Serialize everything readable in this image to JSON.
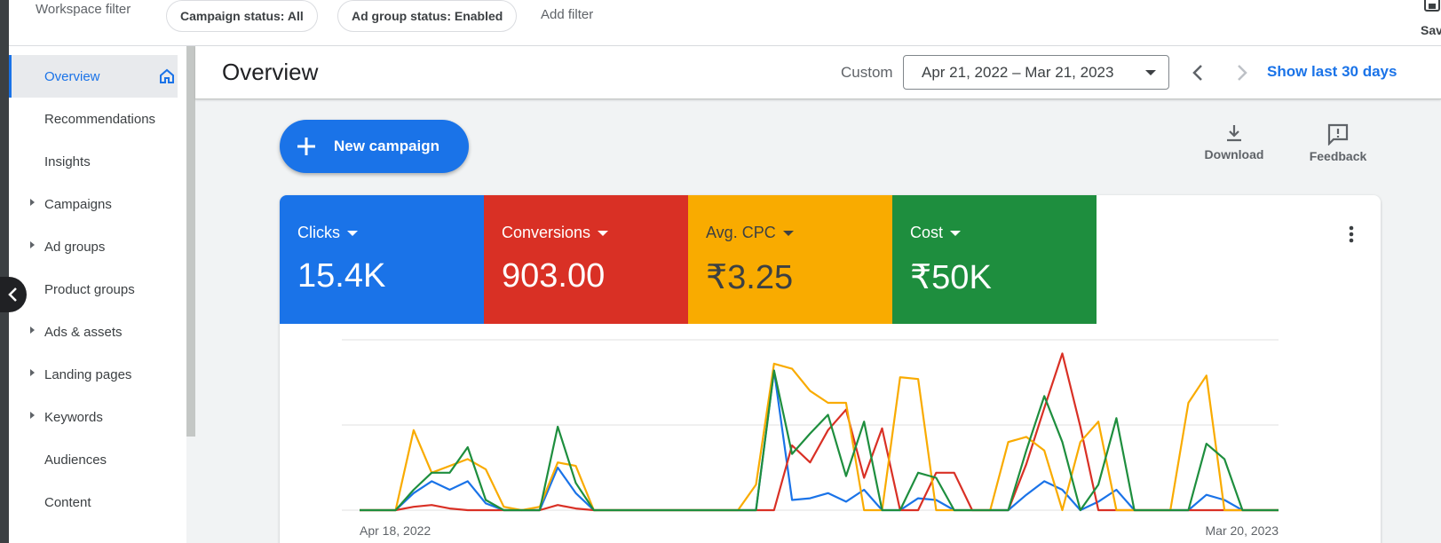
{
  "filter_bar": {
    "workspace_label": "Workspace filter",
    "chips": [
      "Campaign status: All",
      "Ad group status: Enabled"
    ],
    "add_filter": "Add filter",
    "save_label": "Save"
  },
  "sidebar": {
    "items": [
      {
        "label": "Overview",
        "active": true,
        "expandable": false
      },
      {
        "label": "Recommendations",
        "active": false,
        "expandable": false
      },
      {
        "label": "Insights",
        "active": false,
        "expandable": false
      },
      {
        "label": "Campaigns",
        "active": false,
        "expandable": true
      },
      {
        "label": "Ad groups",
        "active": false,
        "expandable": true
      },
      {
        "label": "Product groups",
        "active": false,
        "expandable": false
      },
      {
        "label": "Ads & assets",
        "active": false,
        "expandable": true
      },
      {
        "label": "Landing pages",
        "active": false,
        "expandable": true
      },
      {
        "label": "Keywords",
        "active": false,
        "expandable": true
      },
      {
        "label": "Audiences",
        "active": false,
        "expandable": false
      },
      {
        "label": "Content",
        "active": false,
        "expandable": false
      }
    ]
  },
  "header": {
    "title": "Overview",
    "range_type": "Custom",
    "date_range": "Apr 21, 2022 – Mar 21, 2023",
    "show_last": "Show last 30 days"
  },
  "actions": {
    "new_campaign": "New campaign",
    "download": "Download",
    "feedback": "Feedback"
  },
  "metrics": [
    {
      "label": "Clicks",
      "value": "15.4K",
      "color": "#1a73e8"
    },
    {
      "label": "Conversions",
      "value": "903.00",
      "color": "#d93025"
    },
    {
      "label": "Avg. CPC",
      "value": "₹3.25",
      "color": "#f9ab00"
    },
    {
      "label": "Cost",
      "value": "₹50K",
      "color": "#1e8e3e"
    }
  ],
  "chart_data": {
    "type": "line",
    "x_start_label": "Apr 18, 2022",
    "x_end_label": "Mar 20, 2023",
    "ylim": [
      0,
      100
    ],
    "grid": true,
    "series": [
      {
        "color": "#1a73e8",
        "values": [
          0,
          0,
          0,
          10,
          17,
          12,
          17,
          4,
          0,
          0,
          0,
          25,
          10,
          0,
          0,
          0,
          0,
          0,
          0,
          0,
          0,
          0,
          0,
          82,
          6,
          7,
          10,
          5,
          12,
          0,
          0,
          7,
          6,
          0,
          0,
          0,
          0,
          9,
          17,
          12,
          0,
          5,
          12,
          0,
          0,
          0,
          0,
          9,
          6,
          0,
          0,
          0
        ]
      },
      {
        "color": "#d93025",
        "values": [
          0,
          0,
          0,
          2,
          3,
          1,
          0,
          0,
          0,
          0,
          0,
          3,
          1,
          0,
          0,
          0,
          0,
          0,
          0,
          0,
          0,
          0,
          0,
          0,
          38,
          28,
          47,
          59,
          19,
          48,
          0,
          0,
          22,
          22,
          0,
          0,
          0,
          27,
          60,
          92,
          49,
          0,
          0,
          0,
          0,
          0,
          0,
          0,
          0,
          0,
          0,
          0
        ]
      },
      {
        "color": "#f9ab00",
        "values": [
          0,
          0,
          0,
          47,
          22,
          26,
          30,
          24,
          2,
          0,
          2,
          28,
          26,
          0,
          0,
          0,
          0,
          0,
          0,
          0,
          0,
          0,
          15,
          86,
          83,
          70,
          63,
          63,
          0,
          0,
          78,
          77,
          0,
          0,
          0,
          0,
          40,
          43,
          35,
          0,
          40,
          52,
          0,
          0,
          0,
          0,
          63,
          79,
          0,
          0,
          0,
          0
        ]
      },
      {
        "color": "#1e8e3e",
        "values": [
          0,
          0,
          0,
          12,
          22,
          22,
          37,
          6,
          0,
          0,
          0,
          49,
          16,
          0,
          0,
          0,
          0,
          0,
          0,
          0,
          0,
          0,
          0,
          82,
          33,
          45,
          56,
          20,
          52,
          0,
          0,
          22,
          19,
          0,
          0,
          0,
          0,
          35,
          67,
          40,
          0,
          15,
          54,
          0,
          0,
          0,
          0,
          39,
          30,
          0,
          0,
          0
        ]
      }
    ]
  }
}
